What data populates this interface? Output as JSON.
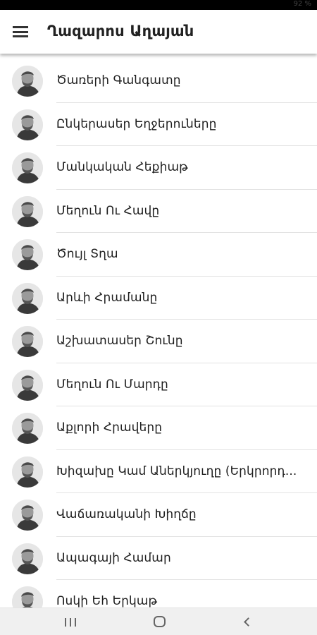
{
  "status_bar": {
    "text": "92 %"
  },
  "app_bar": {
    "title": "Ղազարոս Աղայան",
    "menu_icon": "hamburger-menu-icon"
  },
  "list": {
    "items": [
      {
        "label": "Ծառերի Գանգատը"
      },
      {
        "label": "Ընկերասեր Եղջերուները"
      },
      {
        "label": "Մանկական Հեքիաթ"
      },
      {
        "label": "Մեղուն Ու Հավը"
      },
      {
        "label": "Ծույլ Տղա"
      },
      {
        "label": "Արևի Հրամանը"
      },
      {
        "label": "Աշխատասեր Շունը"
      },
      {
        "label": "Մեղուն Ու Մարդը"
      },
      {
        "label": "Աքլորի Հրավերը"
      },
      {
        "label": "Խիզախը Կամ Աներկյուղը (Երկրորդ..."
      },
      {
        "label": "Վաճառականի Խիղճը"
      },
      {
        "label": "Ապագայի Համար"
      },
      {
        "label": "Ոսկի Եհ Երկաթ"
      }
    ]
  },
  "nav_bar": {
    "recents_icon": "recents-icon",
    "home_icon": "home-icon",
    "back_icon": "back-icon"
  }
}
